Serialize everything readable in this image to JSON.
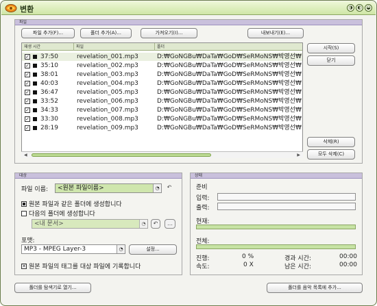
{
  "window": {
    "title": "변환",
    "controls": [
      "◑",
      "◐",
      "◒"
    ]
  },
  "files": {
    "section_label": "파일",
    "buttons": {
      "add_files": "파일 추가(F)...",
      "add_folder": "폴더 추가(A)...",
      "import": "가져오기(I)...",
      "export": "내보내기(E)..."
    },
    "side_buttons": {
      "start": "시작(S)",
      "close": "닫기",
      "delete": "삭제(R)",
      "delete_all": "모두 삭제(C)"
    },
    "columns": [
      "재생 시간",
      "파일",
      "폴더"
    ],
    "rows": [
      {
        "checked": true,
        "time": "37:50",
        "file": "revelation_001.mp3",
        "folder": "D:₩GoNGBu₩DaTa₩GoD₩SeRMoNS₩박영선₩"
      },
      {
        "checked": true,
        "time": "35:10",
        "file": "revelation_002.mp3",
        "folder": "D:₩GoNGBu₩DaTa₩GoD₩SeRMoNS₩박영선₩"
      },
      {
        "checked": true,
        "time": "38:01",
        "file": "revelation_003.mp3",
        "folder": "D:₩GoNGBu₩DaTa₩GoD₩SeRMoNS₩박영선₩"
      },
      {
        "checked": true,
        "time": "40:03",
        "file": "revelation_004.mp3",
        "folder": "D:₩GoNGBu₩DaTa₩GoD₩SeRMoNS₩박영선₩"
      },
      {
        "checked": true,
        "time": "36:47",
        "file": "revelation_005.mp3",
        "folder": "D:₩GoNGBu₩DaTa₩GoD₩SeRMoNS₩박영선₩"
      },
      {
        "checked": true,
        "time": "33:52",
        "file": "revelation_006.mp3",
        "folder": "D:₩GoNGBu₩DaTa₩GoD₩SeRMoNS₩박영선₩"
      },
      {
        "checked": true,
        "time": "34:33",
        "file": "revelation_007.mp3",
        "folder": "D:₩GoNGBu₩DaTa₩GoD₩SeRMoNS₩박영선₩"
      },
      {
        "checked": true,
        "time": "33:30",
        "file": "revelation_008.mp3",
        "folder": "D:₩GoNGBu₩DaTa₩GoD₩SeRMoNS₩박영선₩"
      },
      {
        "checked": true,
        "time": "28:19",
        "file": "revelation_009.mp3",
        "folder": "D:₩GoNGBu₩DaTa₩GoD₩SeRMoNS₩박영선₩"
      }
    ]
  },
  "target": {
    "section_label": "대상",
    "filename_label": "파일 이름:",
    "filename_value": "<원본 파일이름>",
    "option_same_folder": "원본 파일과 같은 폴더에 생성합니다",
    "option_other_folder": "다음의 폴더에 생성합니다",
    "folder_value": "<내 문서>",
    "format_label": "포맷:",
    "format_value": "MP3 - MPEG Layer-3",
    "settings_button": "설정...",
    "copy_tags_label": "원본 파일의 태그를 대상 파일에 기록합니다",
    "copy_tags_checked": true
  },
  "status": {
    "section_label": "상태",
    "ready": "준비",
    "input_label": "입력:",
    "output_label": "출력:",
    "current_label": "현재:",
    "total_label": "전체:",
    "progress_label": "진행:",
    "progress_value": "0 %",
    "elapsed_label": "경과 시간:",
    "elapsed_value": "00:00",
    "speed_label": "속도:",
    "speed_value": "0 X",
    "remaining_label": "남은 시간:",
    "remaining_value": "00:00",
    "current_progress": 0,
    "total_progress": 0
  },
  "footer": {
    "left_button": "폴더를 탐색기로 열기...",
    "right_button": "폴더를 음악 목록에 추가..."
  }
}
